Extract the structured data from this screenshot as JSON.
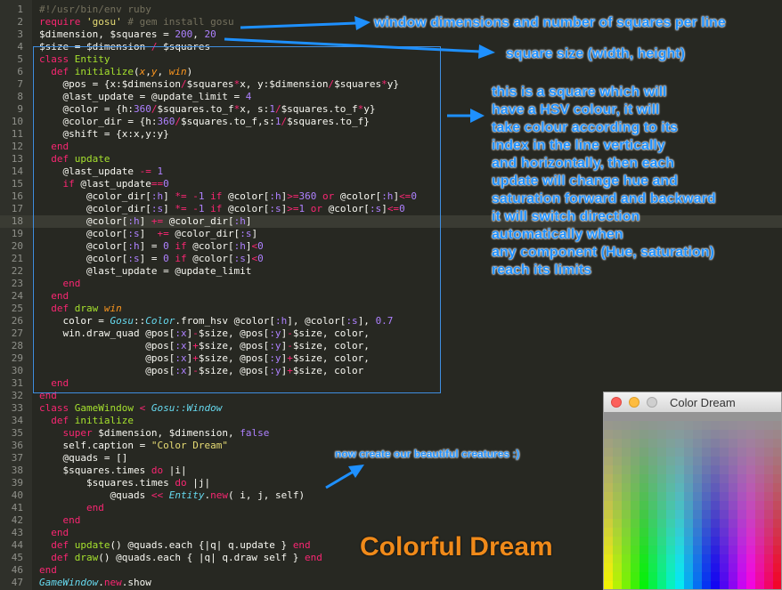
{
  "editor": {
    "lines": [
      {
        "n": "1",
        "html": "<span class='cm'>#!/usr/bin/env ruby</span>"
      },
      {
        "n": "2",
        "html": "<span class='kw'>require</span> <span class='str'>'gosu'</span> <span class='cm'># gem install gosu</span>"
      },
      {
        "n": "3",
        "html": "$dimension, $squares = <span class='num'>200</span>, <span class='num'>20</span>"
      },
      {
        "n": "4",
        "html": "$size = $dimension <span class='kw'>/</span> $squares"
      },
      {
        "n": "5",
        "html": "<span class='kw'>class</span> <span class='fn'>Entity</span>"
      },
      {
        "n": "6",
        "html": "  <span class='kw'>def</span> <span class='fn'>initialize</span>(<span class='var'>x</span>,<span class='var'>y</span>, <span class='var'>win</span>)"
      },
      {
        "n": "7",
        "html": "    @pos = {x:$dimension<span class='kw'>/</span>$squares<span class='kw'>*</span>x, y:$dimension<span class='kw'>/</span>$squares<span class='kw'>*</span>y}"
      },
      {
        "n": "8",
        "html": "    @last_update = @update_limit = <span class='num'>4</span>"
      },
      {
        "n": "9",
        "html": "    @color = {h:<span class='num'>360</span><span class='kw'>/</span>$squares.to_f<span class='kw'>*</span>x, s:<span class='num'>1</span><span class='kw'>/</span>$squares.to_f<span class='kw'>*</span>y}"
      },
      {
        "n": "10",
        "html": "    @color_dir = {h:<span class='num'>360</span><span class='kw'>/</span>$squares.to_f,s:<span class='num'>1</span><span class='kw'>/</span>$squares.to_f}"
      },
      {
        "n": "11",
        "html": "    @shift = {x:x,y:y}"
      },
      {
        "n": "12",
        "html": "  <span class='kw'>end</span>"
      },
      {
        "n": "13",
        "html": "  <span class='kw'>def</span> <span class='fn'>update</span>"
      },
      {
        "n": "14",
        "html": "    @last_update <span class='kw'>-=</span> <span class='num'>1</span>"
      },
      {
        "n": "15",
        "html": "    <span class='kw'>if</span> @last_update<span class='kw'>==</span><span class='num'>0</span>"
      },
      {
        "n": "16",
        "html": "        @color_dir[<span class='sym'>:h</span>] <span class='kw'>*=</span> <span class='kw'>-</span><span class='num'>1</span> <span class='kw'>if</span> @color[<span class='sym'>:h</span>]<span class='kw'>&gt;=</span><span class='num'>360</span> <span class='kw'>or</span> @color[<span class='sym'>:h</span>]<span class='kw'>&lt;=</span><span class='num'>0</span>"
      },
      {
        "n": "17",
        "html": "        @color_dir[<span class='sym'>:s</span>] <span class='kw'>*=</span> <span class='kw'>-</span><span class='num'>1</span> <span class='kw'>if</span> @color[<span class='sym'>:s</span>]<span class='kw'>&gt;=</span><span class='num'>1</span> <span class='kw'>or</span> @color[<span class='sym'>:s</span>]<span class='kw'>&lt;=</span><span class='num'>0</span>"
      },
      {
        "n": "18",
        "html": "        @color[<span class='sym'>:h</span>] <span class='kw'>+=</span> @color_dir[<span class='sym'>:h</span>]"
      },
      {
        "n": "19",
        "html": "        @color[<span class='sym'>:s</span>]  <span class='kw'>+=</span> @color_dir[<span class='sym'>:s</span>]"
      },
      {
        "n": "20",
        "html": "        @color[<span class='sym'>:h</span>] = <span class='num'>0</span> <span class='kw'>if</span> @color[<span class='sym'>:h</span>]<span class='kw'>&lt;</span><span class='num'>0</span>"
      },
      {
        "n": "21",
        "html": "        @color[<span class='sym'>:s</span>] = <span class='num'>0</span> <span class='kw'>if</span> @color[<span class='sym'>:s</span>]<span class='kw'>&lt;</span><span class='num'>0</span>"
      },
      {
        "n": "22",
        "html": "        @last_update = @update_limit"
      },
      {
        "n": "23",
        "html": "    <span class='kw'>end</span>"
      },
      {
        "n": "24",
        "html": "  <span class='kw'>end</span>"
      },
      {
        "n": "25",
        "html": "  <span class='kw'>def</span> <span class='fn'>draw</span> <span class='var'>win</span>"
      },
      {
        "n": "26",
        "html": "    color = <span class='cls'>Gosu</span>::<span class='cls'>Color</span>.from_hsv @color[<span class='sym'>:h</span>], @color[<span class='sym'>:s</span>], <span class='num'>0.7</span>"
      },
      {
        "n": "27",
        "html": "    win.draw_quad @pos[<span class='sym'>:x</span>]<span class='kw'>-</span>$size, @pos[<span class='sym'>:y</span>]<span class='kw'>-</span>$size, color,"
      },
      {
        "n": "28",
        "html": "                  @pos[<span class='sym'>:x</span>]<span class='kw'>+</span>$size, @pos[<span class='sym'>:y</span>]<span class='kw'>-</span>$size, color,"
      },
      {
        "n": "29",
        "html": "                  @pos[<span class='sym'>:x</span>]<span class='kw'>+</span>$size, @pos[<span class='sym'>:y</span>]<span class='kw'>+</span>$size, color,"
      },
      {
        "n": "30",
        "html": "                  @pos[<span class='sym'>:x</span>]<span class='kw'>-</span>$size, @pos[<span class='sym'>:y</span>]<span class='kw'>+</span>$size, color"
      },
      {
        "n": "31",
        "html": "  <span class='kw'>end</span>"
      },
      {
        "n": "32",
        "html": "<span class='kw'>end</span>"
      },
      {
        "n": "33",
        "html": "<span class='kw'>class</span> <span class='fn'>GameWindow</span> <span class='kw'>&lt;</span> <span class='cls'>Gosu::Window</span>"
      },
      {
        "n": "34",
        "html": "  <span class='kw'>def</span> <span class='fn'>initialize</span>"
      },
      {
        "n": "35",
        "html": "    <span class='kw'>super</span> $dimension, $dimension, <span class='num'>false</span>"
      },
      {
        "n": "36",
        "html": "    self.caption = <span class='str'>\"Color Dream\"</span>"
      },
      {
        "n": "37",
        "html": "    @quads = []"
      },
      {
        "n": "38",
        "html": "    $squares.times <span class='kw'>do</span> |i|"
      },
      {
        "n": "39",
        "html": "        $squares.times <span class='kw'>do</span> |j|"
      },
      {
        "n": "40",
        "html": "            @quads <span class='kw'>&lt;&lt;</span> <span class='cls'>Entity</span>.<span class='kw'>new</span>( i, j, self)"
      },
      {
        "n": "41",
        "html": "        <span class='kw'>end</span>"
      },
      {
        "n": "42",
        "html": "    <span class='kw'>end</span>"
      },
      {
        "n": "43",
        "html": "  <span class='kw'>end</span>"
      },
      {
        "n": "44",
        "html": "  <span class='kw'>def</span> <span class='fn'>update</span>() @quads.each {|q| q.update } <span class='kw'>end</span>"
      },
      {
        "n": "45",
        "html": "  <span class='kw'>def</span> <span class='fn'>draw</span>() @quads.each { |q| q.draw self } <span class='kw'>end</span>"
      },
      {
        "n": "46",
        "html": "<span class='kw'>end</span>"
      },
      {
        "n": "47",
        "html": "<span class='cls'>GameWindow</span>.<span class='kw'>new</span>.show"
      }
    ],
    "highlighted_line": "18"
  },
  "annotations": {
    "dimensions": "window dimensions and number of squares per line",
    "square_size": "square size (width, height)",
    "square_desc": [
      "this is a square which will",
      "have a HSV colour, it will",
      "take colour according to its",
      "index in the line vertically",
      "and horizontally, then each",
      "update will change hue and",
      "saturation forward and backward",
      "it will switch direction",
      "automatically when",
      "any component (Hue, saturation)",
      "reach its limits"
    ],
    "creatures": "now create our beautiful creatures :)",
    "title": "Colorful Dream"
  },
  "window": {
    "caption": "Color Dream",
    "grid_cols": 20,
    "grid_rows": 20,
    "colors": {
      "close": "#fc605b",
      "minimize": "#fdbc40",
      "zoom": "#cfcfcf"
    }
  }
}
